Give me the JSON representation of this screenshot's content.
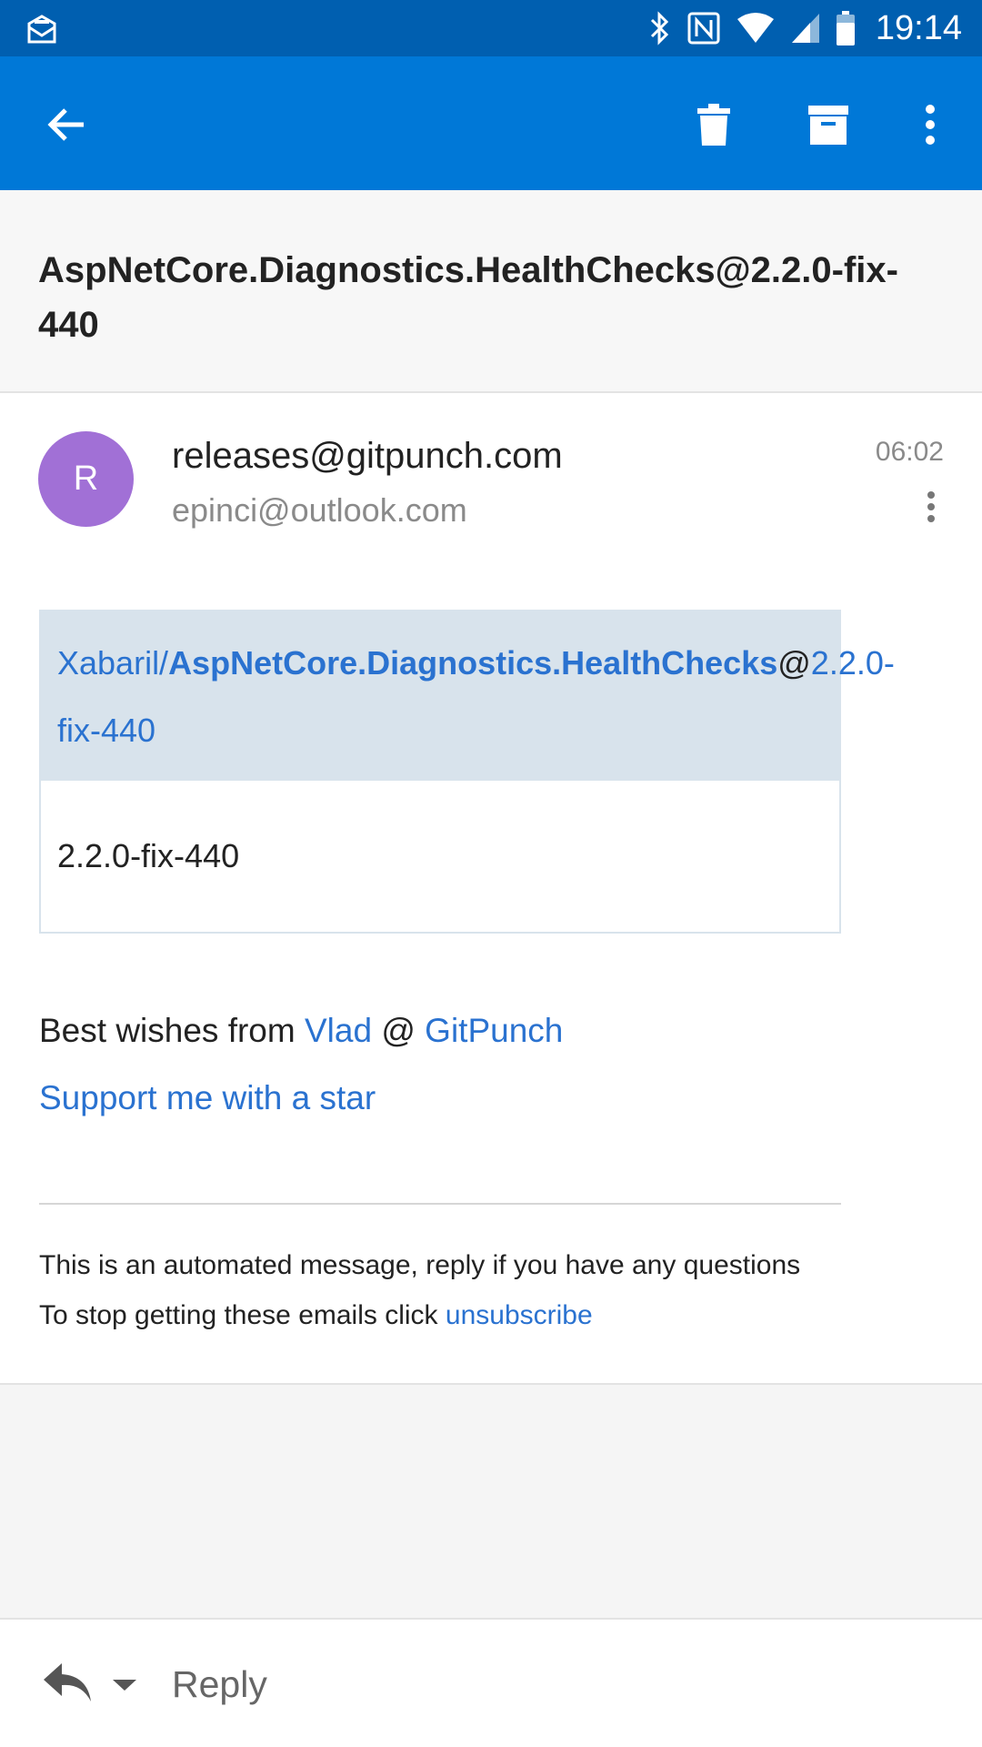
{
  "status_bar": {
    "time": "19:14",
    "icons": [
      "mail-notification-icon",
      "bluetooth-icon",
      "nfc-icon",
      "wifi-icon",
      "signal-icon",
      "battery-icon"
    ]
  },
  "toolbar": {
    "icons": [
      "back-arrow-icon",
      "delete-icon",
      "archive-icon",
      "more-vert-icon"
    ]
  },
  "subject": "AspNetCore.Diagnostics.HealthChecks@2.2.0-fix-440",
  "message": {
    "avatar_initial": "R",
    "avatar_color": "#a170d6",
    "from": "releases@gitpunch.com",
    "to": "epinci@outlook.com",
    "time": "06:02",
    "release": {
      "owner": "Xabaril/",
      "repo": "AspNetCore.Diagnostics.HealthChecks",
      "at": "@",
      "version_part1": "2.2.0-",
      "version_part2": "fix-440",
      "body": "2.2.0-fix-440"
    },
    "greeting": {
      "prefix": "Best wishes from ",
      "author": "Vlad",
      "sep": " @ ",
      "site": "GitPunch"
    },
    "support_link": "Support me with a star",
    "footer": {
      "automated": "This is an automated message, reply if you have any questions",
      "stop_prefix": "To stop getting these emails click ",
      "unsubscribe": "unsubscribe"
    }
  },
  "reply_bar": {
    "label": "Reply"
  },
  "colors": {
    "status_bar": "#005fb0",
    "app_bar": "#0078d7",
    "link": "#2a72d0"
  }
}
